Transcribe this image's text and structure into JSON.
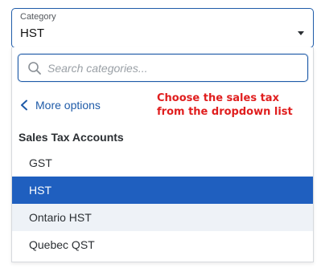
{
  "category_select": {
    "label": "Category",
    "value": "HST"
  },
  "dropdown": {
    "search_placeholder": "Search categories...",
    "more_options_label": "More options",
    "section_header": "Sales Tax Accounts",
    "items": [
      {
        "label": "GST",
        "state": "normal"
      },
      {
        "label": "HST",
        "state": "selected"
      },
      {
        "label": "Ontario HST",
        "state": "hovered"
      },
      {
        "label": "Quebec QST",
        "state": "normal"
      }
    ]
  },
  "annotation": {
    "line1": "Choose the sales tax",
    "line2": "from the dropdown list",
    "color": "#e01e1e"
  },
  "colors": {
    "accent": "#1f5ba8",
    "selected_bg": "#1f5fbf",
    "hover_bg": "#eef2f7"
  }
}
